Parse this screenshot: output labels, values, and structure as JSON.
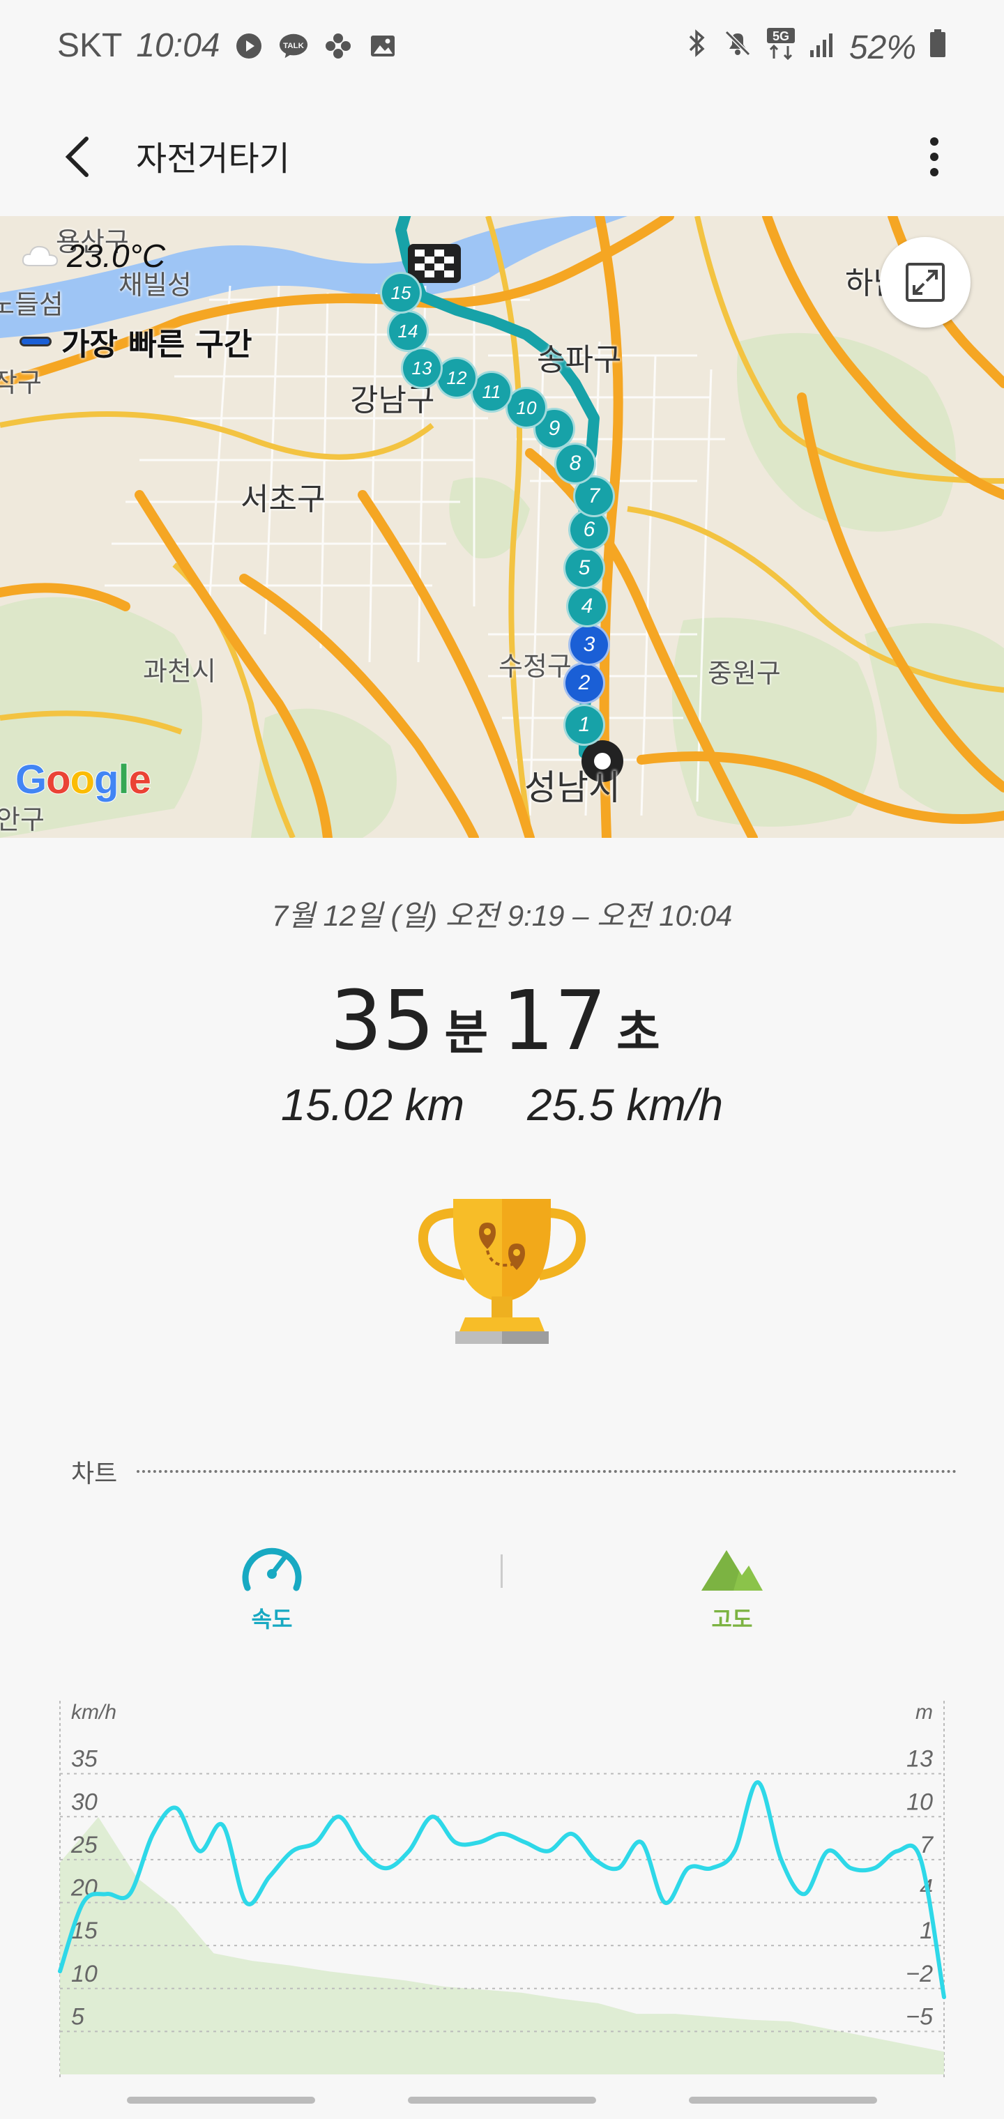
{
  "status_bar": {
    "carrier": "SKT",
    "time": "10:04",
    "battery": "52%",
    "left_icons": [
      "play-icon",
      "talk-icon",
      "flower-icon",
      "image-icon"
    ],
    "right_icons": [
      "bluetooth-icon",
      "mute-icon",
      "5g-icon",
      "signal-icon",
      "battery-icon"
    ]
  },
  "app_bar": {
    "title": "자전거타기"
  },
  "map": {
    "weather": "23.0°C",
    "fastest_label": "가장 빠른 구간",
    "places": [
      "용산구",
      "노들섬",
      "채빌성",
      "작구",
      "강남구",
      "송파구",
      "하남",
      "서초구",
      "과천시",
      "수정구",
      "중원구",
      "성남시",
      "안구"
    ],
    "markers": [
      "1",
      "2",
      "3",
      "4",
      "5",
      "6",
      "7",
      "8",
      "9",
      "10",
      "11",
      "12",
      "13",
      "14",
      "15"
    ],
    "fast_markers": [
      "2",
      "3"
    ],
    "attribution": "Google",
    "colors": {
      "route": "#17a2a8",
      "fast": "#1a5fd6",
      "road": "#f5a623",
      "water": "#9ec5f5"
    }
  },
  "summary": {
    "datetime": "7월 12일 (일) 오전 9:19 – 오전 10:04",
    "minutes": "35",
    "minutes_unit": "분",
    "seconds": "17",
    "seconds_unit": "초",
    "distance": "15.02 km",
    "avg_speed": "25.5 km/h"
  },
  "chart_section": {
    "header": "차트",
    "tabs": [
      {
        "label": "속도",
        "icon": "speedometer-icon"
      },
      {
        "label": "고도",
        "icon": "mountain-icon"
      }
    ]
  },
  "chart_data": {
    "type": "line",
    "left_unit": "km/h",
    "right_unit": "m",
    "left_ticks": [
      "35",
      "30",
      "25",
      "20",
      "15",
      "10",
      "5"
    ],
    "right_ticks": [
      "13",
      "10",
      "7",
      "4",
      "1",
      "−2",
      "−5"
    ],
    "series": [
      {
        "name": "속도",
        "color": "#2ed8e8",
        "values": [
          12,
          20,
          21,
          21,
          28,
          31,
          26,
          29,
          20,
          23,
          26,
          27,
          30,
          26,
          24,
          26,
          30,
          27,
          27,
          28,
          27,
          26,
          28,
          25,
          24,
          27,
          20,
          24,
          24,
          26,
          34,
          25,
          21,
          26,
          24,
          24,
          26,
          25,
          9
        ]
      },
      {
        "name": "고도",
        "color": "#dcebcf",
        "values": [
          7,
          10,
          6,
          4,
          1,
          0.5,
          0.2,
          -0.2,
          -0.5,
          -0.8,
          -1.2,
          -1.4,
          -1.6,
          -2,
          -2.3,
          -3,
          -3,
          -3.2,
          -3.4,
          -3.5,
          -4,
          -4.5,
          -5,
          -5.5
        ]
      }
    ],
    "ylim_left": [
      0,
      37
    ],
    "ylim_right": [
      -7,
      14
    ]
  }
}
